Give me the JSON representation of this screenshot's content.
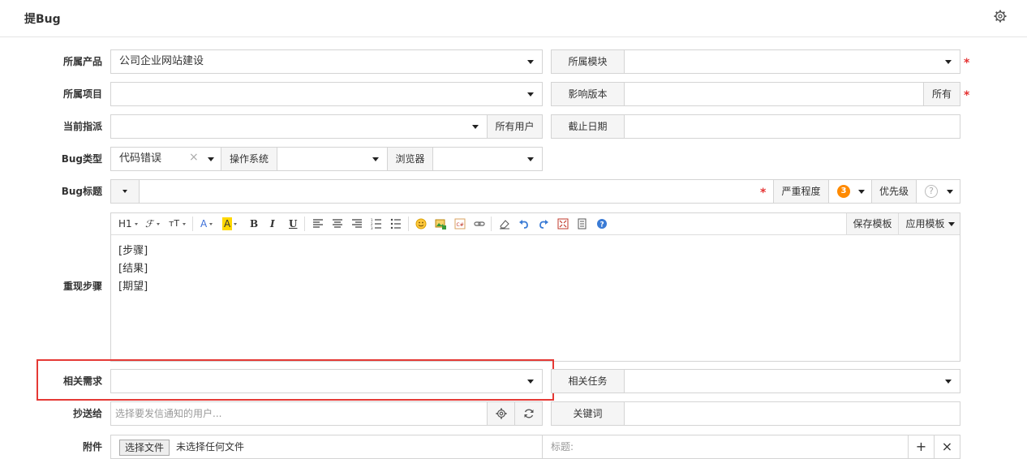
{
  "header": {
    "title": "提Bug",
    "settings_icon": "gear-icon"
  },
  "form": {
    "product_label": "所属产品",
    "product_value": "公司企业网站建设",
    "module_label": "所属模块",
    "project_label": "所属项目",
    "build_label": "影响版本",
    "build_all": "所有",
    "assign_label": "当前指派",
    "assign_all_users": "所有用户",
    "deadline_label": "截止日期",
    "type_label": "Bug类型",
    "type_value": "代码错误",
    "os_label": "操作系统",
    "browser_label": "浏览器",
    "title_label": "Bug标题",
    "severity_label": "严重程度",
    "severity_value": "3",
    "priority_label": "优先级",
    "priority_value": "?",
    "steps_label": "重现步骤",
    "steps_lines": [
      "[步骤]",
      "[结果]",
      "[期望]"
    ],
    "story_label": "相关需求",
    "task_label": "相关任务",
    "mailto_label": "抄送给",
    "mailto_placeholder": "选择要发信通知的用户...",
    "keywords_label": "关键词",
    "files_label": "附件",
    "choose_file": "选择文件",
    "no_file": "未选择任何文件",
    "file_title": "标题:",
    "add": "+",
    "remove": "×"
  },
  "toolbar": {
    "h1": "H1",
    "font": "ℱ",
    "size": "тT",
    "font_color": "A",
    "bg_color": "A",
    "bold": "B",
    "italic": "I",
    "underline": "U",
    "save_template": "保存模板",
    "apply_template": "应用模板"
  },
  "colors": {
    "required": "#e53333",
    "highlight": "#e53935",
    "severity": "#ff8a00"
  }
}
